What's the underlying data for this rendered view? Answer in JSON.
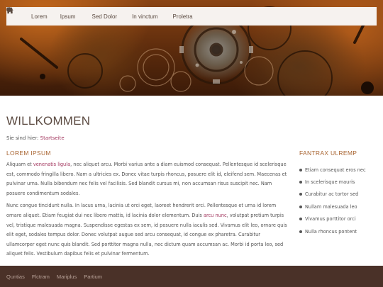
{
  "nav": {
    "home_icon": "home-icon",
    "items": [
      {
        "label": "Lorem",
        "has_dropdown": true
      },
      {
        "label": "Ipsum",
        "has_dropdown": false
      },
      {
        "label": "Sed Dolor",
        "has_dropdown": true
      },
      {
        "label": "In vinctum",
        "has_dropdown": true
      },
      {
        "label": "Proletra",
        "has_dropdown": false
      }
    ],
    "search_icon": "search-icon"
  },
  "page": {
    "title": "WILLKOMMEN",
    "breadcrumb_prefix": "Sie sind hier:",
    "breadcrumb_link": "Startseite"
  },
  "main": {
    "heading": "LOREM IPSUM",
    "p1_a": "Aliquam et ",
    "p1_link": "venenatis ligula",
    "p1_b": ", nec aliquet arcu. Morbi varius ante a diam euismod consequat. Pellentesque id scelerisque est, commodo fringilla libero. Nam a ultricies ex. Donec vitae turpis rhoncus, posuere elit id, eleifend sem. Maecenas et pulvinar urna. Nulla bibendum nec felis vel facilisis. Sed blandit cursus mi, non accumsan risus suscipit nec. Nam posuere condimentum sodales.",
    "p2_a": "Nunc congue tincidunt nulla. In lacus urna, lacinia ut orci eget, laoreet hendrerit orci. Pellentesque et urna id lorem ornare aliquet. Etiam feugiat dui nec libero mattis, id lacinia dolor elementum. Duis ",
    "p2_link": "arcu nunc",
    "p2_b": ", volutpat pretium turpis vel, tristique malesuada magna. Suspendisse egestas ex sem, id posuere nulla iaculis sed. Vivamus elit leo, ornare quis elit eget, sodales tempus dolor. Donec volutpat augue sed arcu consequat, id congue ex pharetra. Curabitur ullamcorper eget nunc quis blandit. Sed porttitor magna nulla, nec dictum quam accumsan ac. Morbi id porta leo, sed aliquet felis. Vestibulum dapibus felis et pulvinar fermentum."
  },
  "sidebar": {
    "heading": "FANTRAX ULREMP",
    "items": [
      "Etiam consequat eros nec",
      "In scelerisque mauris",
      "Curabitur ac tortor sed",
      "Nullam malesuada leo",
      "Vivamus porttitor orci",
      "Nulla rhoncus pontent"
    ]
  },
  "footer": {
    "links": [
      "Quntias",
      "Flctram",
      "Mariplus",
      "Partium"
    ]
  },
  "colors": {
    "accent": "#a96532",
    "link": "#a1345c",
    "footer_bg": "#4a3128",
    "nav_bg": "#f6f2ef"
  }
}
